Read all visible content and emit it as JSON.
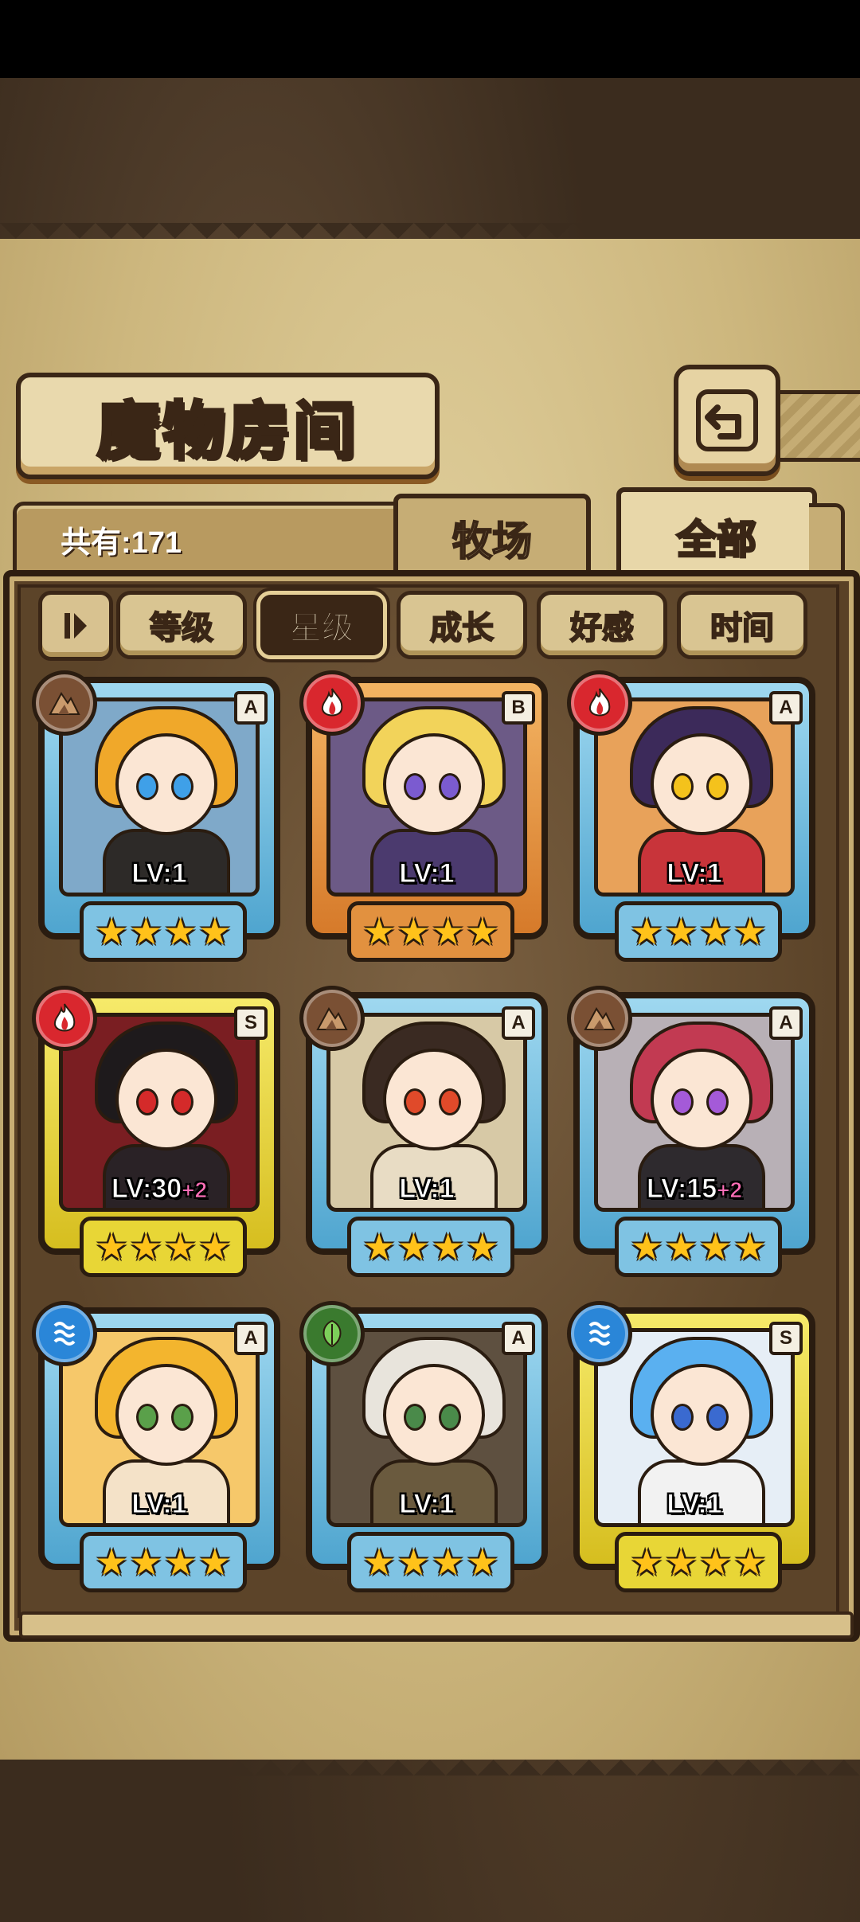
{
  "title": "魔物房间",
  "count_label": "共有:171",
  "tabs": {
    "ranch": "牧场",
    "all": "全部"
  },
  "filters": [
    "等级",
    "星级",
    "成长",
    "好感",
    "时间"
  ],
  "active_filter": "星级",
  "monsters": [
    {
      "rank": "A",
      "element": "earth",
      "level": "LV:1",
      "plus": "",
      "stars": 4,
      "hair": "#f0a82a",
      "eye": "#3fa0e8",
      "outfit": "#2d2a28",
      "bg": "#7fa9c9"
    },
    {
      "rank": "B",
      "element": "fire",
      "level": "LV:1",
      "plus": "",
      "stars": 4,
      "hair": "#f2d35a",
      "eye": "#7b5bd0",
      "outfit": "#4b3a6e",
      "bg": "#6c5a86"
    },
    {
      "rank": "A",
      "element": "fire",
      "level": "LV:1",
      "plus": "",
      "stars": 4,
      "hair": "#3c2a5a",
      "eye": "#f4c21c",
      "outfit": "#c8343a",
      "bg": "#e8a25a"
    },
    {
      "rank": "S",
      "element": "fire",
      "level": "LV:30",
      "plus": "+2",
      "stars": 4,
      "hair": "#1e1a1c",
      "eye": "#d42a2a",
      "outfit": "#2a2226",
      "bg": "#7a1e22"
    },
    {
      "rank": "A",
      "element": "earth",
      "level": "LV:1",
      "plus": "",
      "stars": 4,
      "hair": "#3a2a22",
      "eye": "#e04a2a",
      "outfit": "#e8dcc4",
      "bg": "#d7c9a6"
    },
    {
      "rank": "A",
      "element": "earth",
      "level": "LV:15",
      "plus": "+2",
      "stars": 4,
      "hair": "#c23a52",
      "eye": "#a45ad8",
      "outfit": "#2e2a2e",
      "bg": "#b8b0b6"
    },
    {
      "rank": "A",
      "element": "water",
      "level": "LV:1",
      "plus": "",
      "stars": 4,
      "hair": "#f3b52e",
      "eye": "#5aa04a",
      "outfit": "#f4e2c8",
      "bg": "#f6c86a"
    },
    {
      "rank": "A",
      "element": "wood",
      "level": "LV:1",
      "plus": "",
      "stars": 4,
      "hair": "#e8e4dc",
      "eye": "#4a8a4a",
      "outfit": "#6a5a3e",
      "bg": "#5e5040"
    },
    {
      "rank": "S",
      "element": "water",
      "level": "LV:1",
      "plus": "",
      "stars": 4,
      "hair": "#5ab0f0",
      "eye": "#3a6ad0",
      "outfit": "#f2f2f2",
      "bg": "#e6eef6"
    }
  ]
}
